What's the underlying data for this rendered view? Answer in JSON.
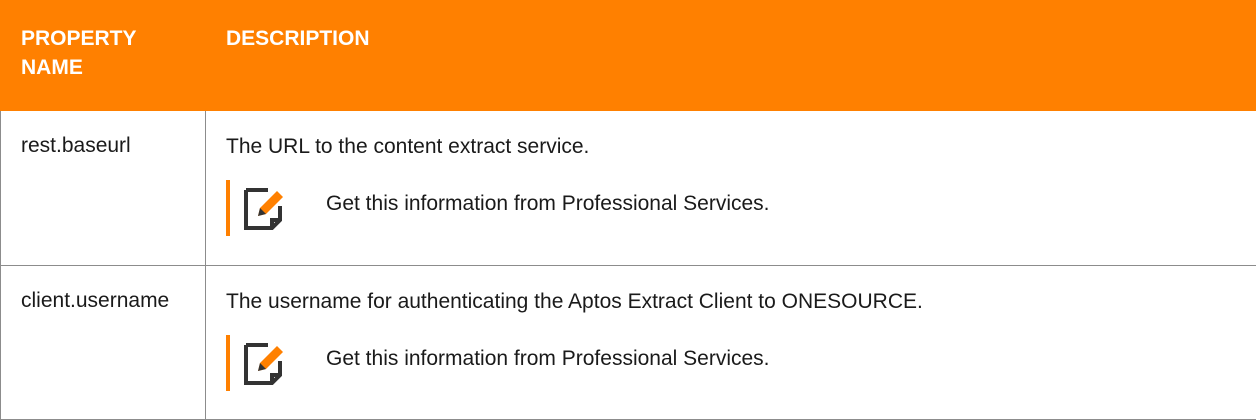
{
  "table": {
    "headers": {
      "property_name": "PROPERTY NAME",
      "description": "DESCRIPTION"
    },
    "rows": [
      {
        "name": "rest.baseurl",
        "description": "The URL to the content extract service.",
        "note": "Get this information from Professional Services."
      },
      {
        "name": "client.username",
        "description": "The username for authenticating the Aptos Extract Client to ONESOURCE.",
        "note": "Get this information from Professional Services."
      }
    ]
  },
  "icons": {
    "note": "note-edit-icon"
  },
  "colors": {
    "accent": "#ff8000",
    "header_text": "#ffffff",
    "body_text": "#1a1a1a",
    "border": "#8c8c8c"
  }
}
